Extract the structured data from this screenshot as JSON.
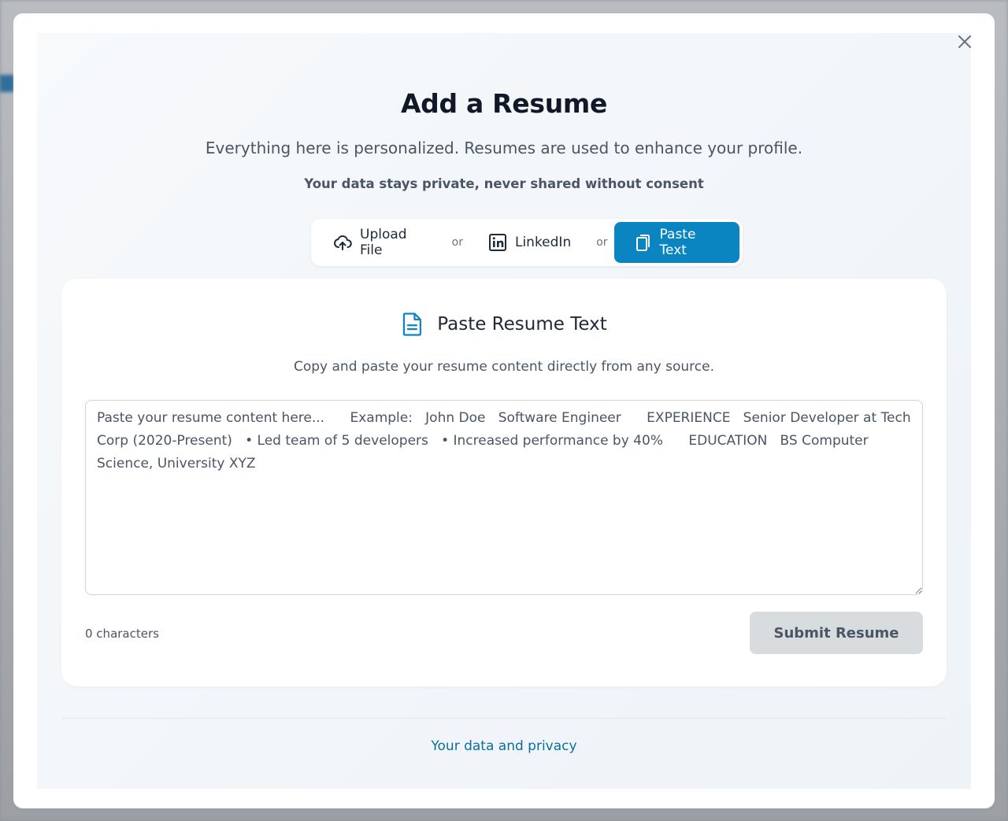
{
  "modal": {
    "title": "Add a Resume",
    "subtitle": "Everything here is personalized. Resumes are used to enhance your profile.",
    "privacy_note": "Your data stays private, never shared without consent"
  },
  "methods": {
    "upload_label": "Upload File",
    "linkedin_label": "LinkedIn",
    "paste_label": "Paste Text",
    "separator": "or",
    "active": "Paste Text"
  },
  "paste_card": {
    "title": "Paste Resume Text",
    "description": "Copy and paste your resume content directly from any source.",
    "textarea_value": "",
    "textarea_placeholder": "Paste your resume content here...      Example:   John Doe   Software Engineer      EXPERIENCE   Senior Developer at Tech Corp (2020-Present)   • Led team of 5 developers   • Increased performance by 40%      EDUCATION   BS Computer Science, University XYZ",
    "char_count": "0 characters",
    "submit_label": "Submit Resume"
  },
  "footer": {
    "privacy_link": "Your data and privacy"
  },
  "colors": {
    "accent": "#0a85c2",
    "link": "#0a6e9e",
    "disabled_button": "#d9dcdf"
  },
  "icons": {
    "close": "close-icon",
    "upload": "cloud-upload-icon",
    "linkedin": "linkedin-icon",
    "paste": "clipboard-icon",
    "document": "document-icon"
  }
}
